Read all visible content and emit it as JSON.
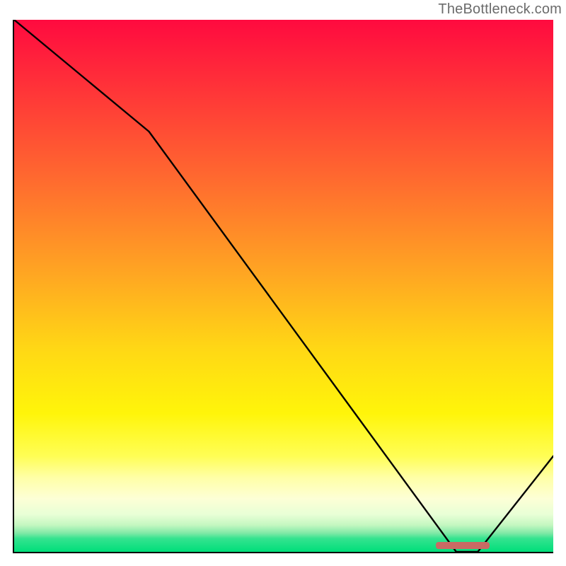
{
  "watermark": "TheBottleneck.com",
  "colors": {
    "top": "#ff0a3f",
    "upper_mid": "#ff6a2f",
    "mid": "#ffd815",
    "lower_mid": "#fffe55",
    "near_bottom": "#c3f7c0",
    "bottom": "#00de7a",
    "line": "#000000",
    "marker": "#c96a64"
  },
  "chart_data": {
    "type": "line",
    "x": [
      0,
      25,
      82,
      86,
      100
    ],
    "values": [
      100,
      79,
      0,
      0,
      18
    ],
    "title": "",
    "xlabel": "",
    "ylabel": "",
    "xlim": [
      0,
      100
    ],
    "ylim": [
      0,
      100
    ],
    "marker": {
      "x_start": 78,
      "x_end": 88,
      "y": 0
    },
    "annotations": [
      "TheBottleneck.com"
    ]
  }
}
